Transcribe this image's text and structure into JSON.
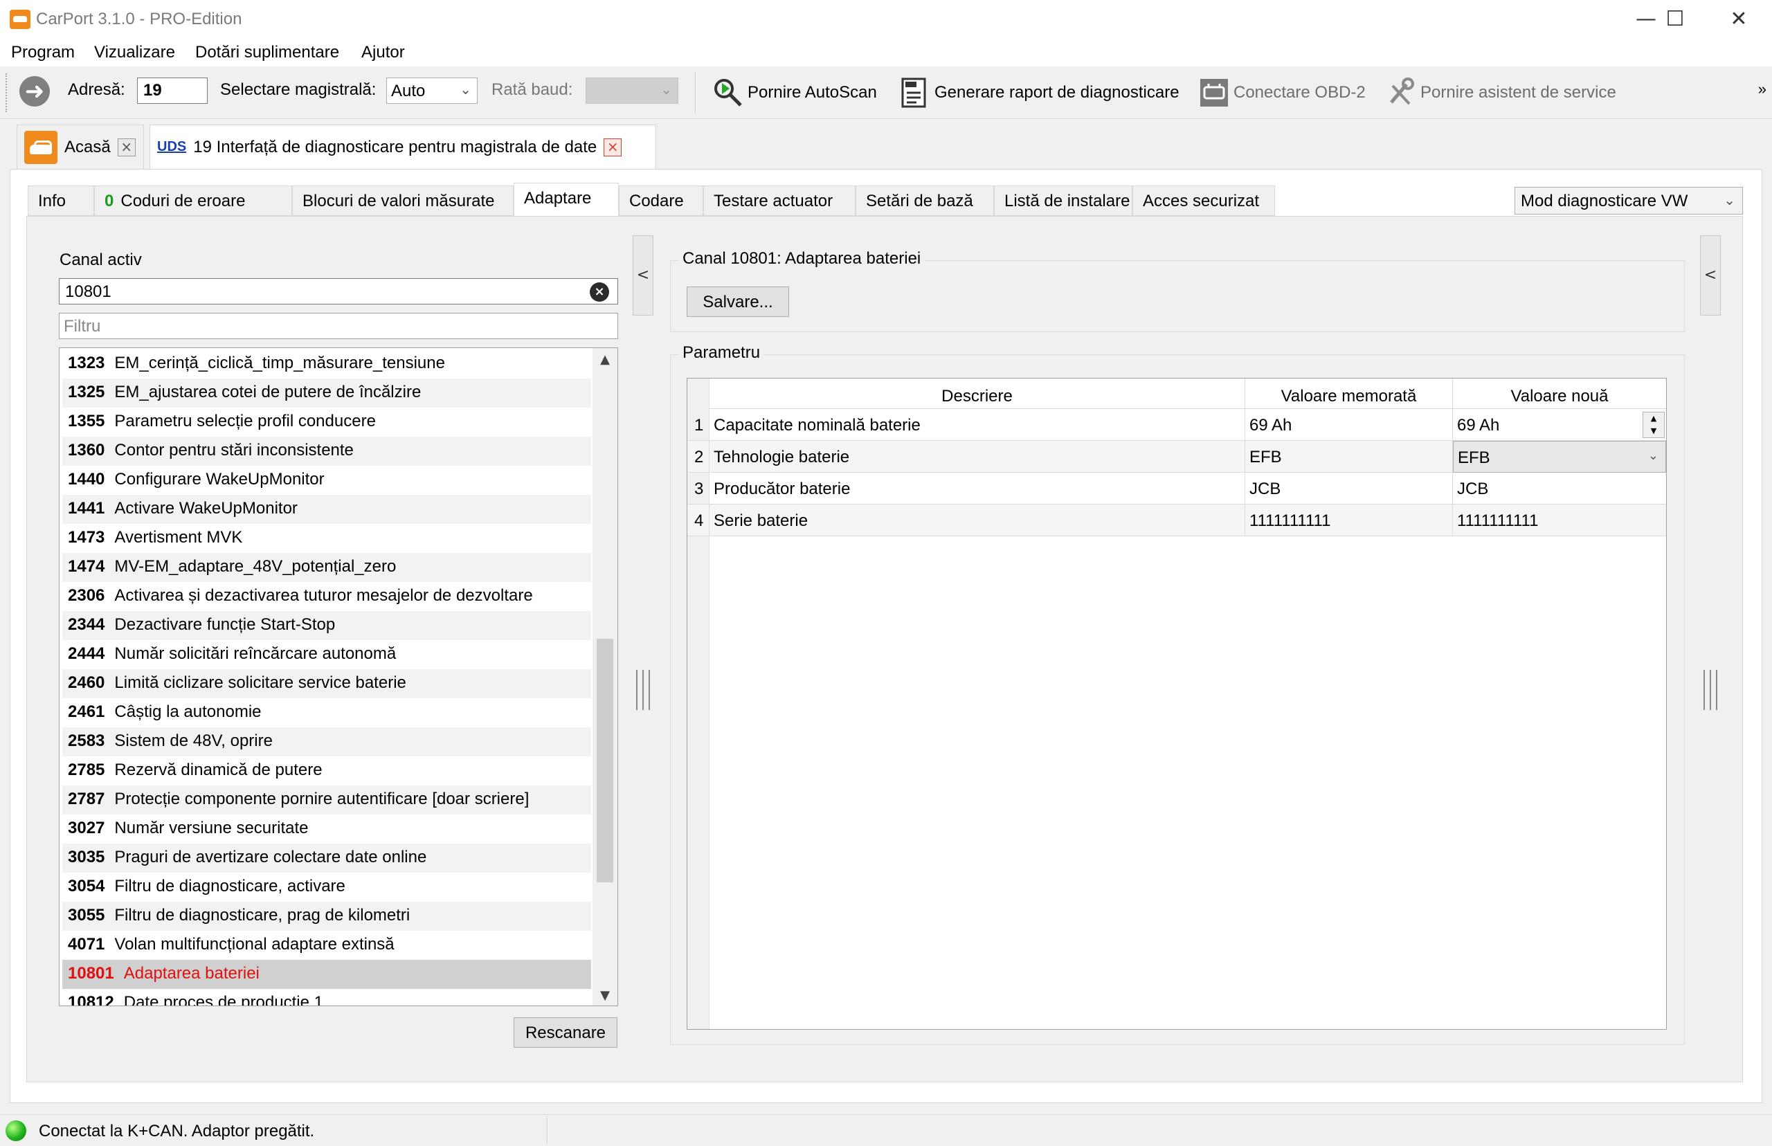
{
  "window": {
    "title": "CarPort 3.1.0 - PRO-Edition",
    "minimize": "—",
    "maximize": "☐",
    "close": "✕"
  },
  "menu": [
    "Program",
    "Vizualizare",
    "Dotări suplimentare",
    "Ajutor"
  ],
  "toolbar": {
    "address_label": "Adresă:",
    "address_value": "19",
    "bus_label": "Selectare magistrală:",
    "bus_value": "Auto",
    "baud_label": "Rată baud:",
    "baud_value": "",
    "autoscan": "Pornire AutoScan",
    "report": "Generare raport de diagnosticare",
    "obd": "Conectare OBD-2",
    "assistant": "Pornire asistent de service",
    "overflow": "»",
    "icons": [
      "forward-arrow-icon",
      "autoscan-icon",
      "report-icon",
      "obd-icon",
      "service-assistant-icon"
    ]
  },
  "doc_tabs": {
    "home": "Acasă",
    "uds_badge": "UDS",
    "module": "19 Interfață de diagnosticare pentru magistrala de date"
  },
  "sub_tabs": {
    "info": "Info",
    "error_count": "0",
    "error_codes": "Coduri de eroare",
    "measured_blocks": "Blocuri de valori măsurate",
    "adaptation": "Adaptare",
    "coding": "Codare",
    "actuator_test": "Testare actuator",
    "basic_settings": "Setări de bază",
    "install_list": "Listă de instalare",
    "secure_access": "Acces securizat"
  },
  "mode_select": "Mod diagnosticare VW",
  "left": {
    "active_channel_label": "Canal activ",
    "channel_value": "10801",
    "filter_placeholder": "Filtru",
    "rescan": "Rescanare",
    "items": [
      {
        "code": "1323",
        "name": "EM_cerință_ciclică_timp_măsurare_tensiune"
      },
      {
        "code": "1325",
        "name": "EM_ajustarea cotei de putere de încălzire"
      },
      {
        "code": "1355",
        "name": "Parametru selecție profil conducere"
      },
      {
        "code": "1360",
        "name": "Contor pentru stări inconsistente"
      },
      {
        "code": "1440",
        "name": "Configurare WakeUpMonitor"
      },
      {
        "code": "1441",
        "name": "Activare WakeUpMonitor"
      },
      {
        "code": "1473",
        "name": "Avertisment MVK"
      },
      {
        "code": "1474",
        "name": "MV-EM_adaptare_48V_potențial_zero"
      },
      {
        "code": "2306",
        "name": "Activarea și dezactivarea tuturor mesajelor de dezvoltare"
      },
      {
        "code": "2344",
        "name": "Dezactivare funcție Start-Stop"
      },
      {
        "code": "2444",
        "name": "Număr solicitări reîncărcare autonomă"
      },
      {
        "code": "2460",
        "name": "Limită ciclizare solicitare service baterie"
      },
      {
        "code": "2461",
        "name": "Câștig la autonomie"
      },
      {
        "code": "2583",
        "name": "Sistem de 48V, oprire"
      },
      {
        "code": "2785",
        "name": "Rezervă dinamică de putere"
      },
      {
        "code": "2787",
        "name": "Protecție componente pornire autentificare [doar scriere]"
      },
      {
        "code": "3027",
        "name": "Număr versiune securitate"
      },
      {
        "code": "3035",
        "name": "Praguri de avertizare colectare date online"
      },
      {
        "code": "3054",
        "name": "Filtru de diagnosticare, activare"
      },
      {
        "code": "3055",
        "name": "Filtru de diagnosticare, prag de kilometri"
      },
      {
        "code": "4071",
        "name": "Volan multifuncțional adaptare extinsă"
      },
      {
        "code": "10801",
        "name": "Adaptarea bateriei"
      },
      {
        "code": "10812",
        "name": "Date proces de producție 1"
      }
    ]
  },
  "right": {
    "channel_group_title": "Canal 10801: Adaptarea bateriei",
    "save": "Salvare...",
    "param_group_title": "Parametru",
    "columns": [
      "Descriere",
      "Valoare memorată",
      "Valoare nouă"
    ],
    "rows": [
      {
        "n": "1",
        "desc": "Capacitate nominală baterie",
        "stored": "69 Ah",
        "new": "69 Ah"
      },
      {
        "n": "2",
        "desc": "Tehnologie baterie",
        "stored": "EFB",
        "new": "EFB"
      },
      {
        "n": "3",
        "desc": "Producător baterie",
        "stored": "JCB",
        "new": "JCB"
      },
      {
        "n": "4",
        "desc": "Serie baterie",
        "stored": "1111111111",
        "new": "1111111111"
      }
    ]
  },
  "collapse_glyph": "<",
  "status": {
    "text": "Conectat la K+CAN. Adaptor pregătit.",
    "led_color": "#22b51c"
  },
  "colors": {
    "accent_orange": "#f08a1c",
    "selected_text": "#e01010",
    "error_count_green": "#1a9b1a",
    "uds_blue": "#1a3fb0"
  }
}
